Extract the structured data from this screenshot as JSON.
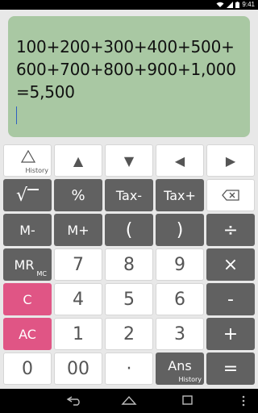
{
  "status": {
    "time": "9:41"
  },
  "display": {
    "expression": "100+200+300+400+500+600+700+800+900+1,000",
    "result": "=5,500"
  },
  "keys": {
    "history_sub": "History",
    "up": "▲",
    "down": "▼",
    "left": "◀",
    "right": "▶",
    "sqrt": "√",
    "percent": "%",
    "tax_minus": "Tax-",
    "tax_plus": "Tax+",
    "m_minus": "M-",
    "m_plus": "M+",
    "paren_open": "(",
    "paren_close": ")",
    "divide": "÷",
    "mr": "MR",
    "mr_sub": "MC",
    "seven": "7",
    "eight": "8",
    "nine": "9",
    "multiply": "×",
    "c": "C",
    "four": "4",
    "five": "5",
    "six": "6",
    "minus": "-",
    "ac": "AC",
    "one": "1",
    "two": "2",
    "three": "3",
    "plus": "+",
    "zero": "0",
    "double_zero": "00",
    "dot": "·",
    "ans": "Ans",
    "ans_sub": "History",
    "equals": "="
  },
  "colors": {
    "display_bg": "#a9c8a3",
    "dark_key": "#616161",
    "pink_key": "#e05585",
    "white_key": "#ffffff"
  },
  "icons": {
    "wifi": "wifi-icon",
    "signal": "signal-icon",
    "battery": "battery-icon",
    "backspace": "backspace-icon",
    "history": "triangle-history-icon",
    "nav_back": "back-icon",
    "nav_home": "home-icon",
    "nav_recent": "recent-apps-icon"
  }
}
